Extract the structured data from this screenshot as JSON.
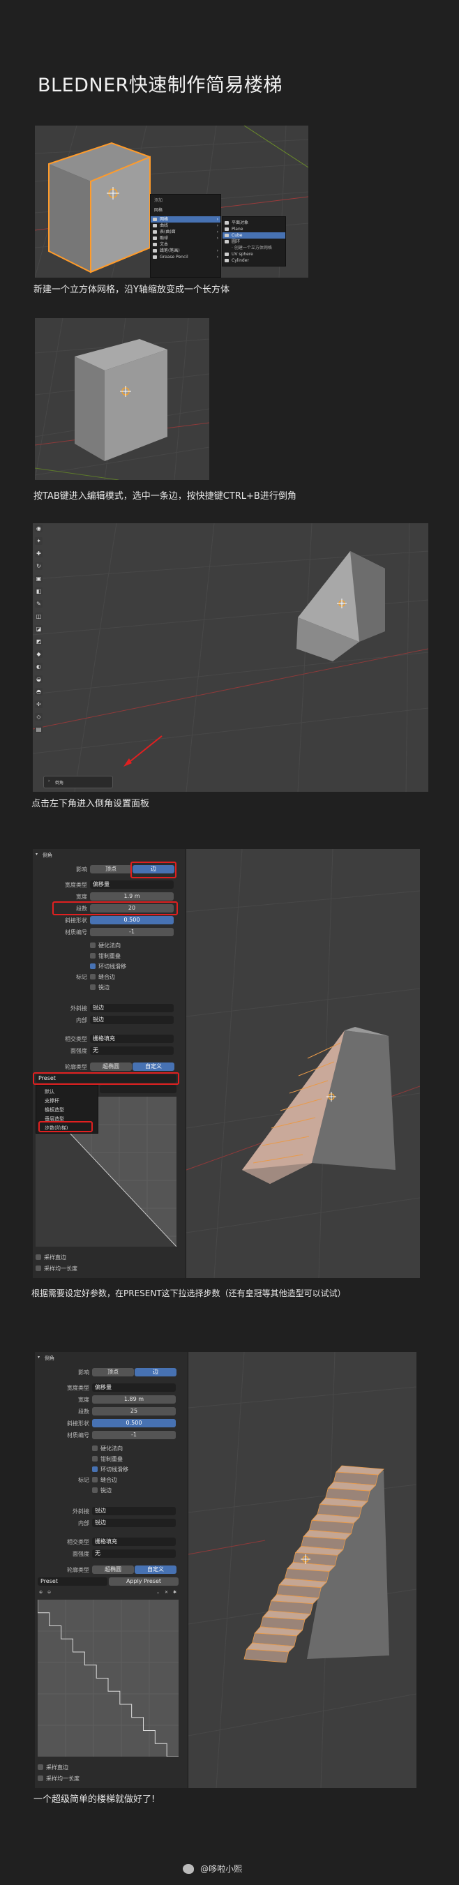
{
  "title": "BLEDNER快速制作简易楼梯",
  "steps": {
    "s1": "新建一个立方体网格，沿Y轴缩放变成一个长方体",
    "s2": "按TAB键进入编辑模式，选中一条边，按快捷键CTRL+B进行倒角",
    "s3": "点击左下角进入倒角设置面板",
    "s4": "根据需要设定好参数，在PRESENT这下拉选择步数（还有皇冠等其他造型可以试试）",
    "s5": "一个超级简单的楼梯就做好了!"
  },
  "add_menu": {
    "header": "添加",
    "title": "网格",
    "items": [
      {
        "label": "网格",
        "icon": "mesh-icon",
        "highlight": true
      },
      {
        "label": "曲线",
        "icon": "curve-icon"
      },
      {
        "label": "表(曲)面",
        "icon": "surface-icon"
      },
      {
        "label": "融球",
        "icon": "metaball-icon"
      },
      {
        "label": "文本",
        "icon": "text-icon"
      },
      {
        "label": "蜡笔(笔画)",
        "icon": "gpencil-icon"
      },
      {
        "label": "Grease Pencil",
        "icon": "grease-pencil-icon"
      }
    ],
    "sub_items": [
      {
        "label": "平面对象"
      },
      {
        "label": "Plane"
      },
      {
        "label": "Cube",
        "highlight": true
      },
      {
        "label": "圆环"
      },
      {
        "label": "· 创建一个立方体网格"
      },
      {
        "label": "UV sphere"
      },
      {
        "label": "Cylinder"
      }
    ]
  },
  "bevel_mini_label": "倒角",
  "panel1": {
    "header": "倒角",
    "affect_label": "影响",
    "affect_vertex": "顶点",
    "affect_edge": "边",
    "width_type_label": "宽度类型",
    "width_type": "偏移量",
    "width_label": "宽度",
    "width": "1.9 m",
    "segments_label": "段数",
    "segments": "20",
    "shape_label": "斜接形状",
    "shape": "0.500",
    "material_label": "材质编号",
    "material": "-1",
    "opt_harden": "硬化法向",
    "opt_clamp": "钳制重叠",
    "opt_loop": "环切线滑移",
    "mark_label": "标记",
    "opt_seam": "缝合边",
    "opt_sharp": "锐边",
    "outer_label": "外斜接",
    "outer": "锐边",
    "inner_label": "内部",
    "inner": "锐边",
    "fill_label": "相交类型",
    "fill": "栅格填充",
    "face_label": "面强度",
    "face": "无",
    "profile_label": "轮廓类型",
    "profile_a": "超椭圆",
    "profile_b": "自定义",
    "preset": "Preset",
    "preset_opts": [
      "默认",
      "支撑杆",
      "檐板造型",
      "垂层造型",
      "步数(阶梯)"
    ],
    "opt_sample": "采样直边",
    "opt_even": "采样均一长度"
  },
  "panel2": {
    "header": "倒角",
    "affect_label": "影响",
    "affect_vertex": "顶点",
    "affect_edge": "边",
    "width_type_label": "宽度类型",
    "width_type": "偏移量",
    "width_label": "宽度",
    "width": "1.89 m",
    "segments_label": "段数",
    "segments": "25",
    "shape_label": "斜接形状",
    "shape": "0.500",
    "material_label": "材质编号",
    "material": "-1",
    "opt_harden": "硬化法向",
    "opt_clamp": "钳制重叠",
    "opt_loop": "环切线滑移",
    "mark_label": "标记",
    "opt_seam": "缝合边",
    "opt_sharp": "锐边",
    "outer_label": "外斜接",
    "outer": "锐边",
    "inner_label": "内部",
    "inner": "锐边",
    "fill_label": "相交类型",
    "fill": "栅格填充",
    "face_label": "面强度",
    "face": "无",
    "profile_label": "轮廓类型",
    "profile_a": "超椭圆",
    "profile_b": "自定义",
    "preset": "Preset",
    "apply_preset": "Apply Preset",
    "opt_sample": "采样直边",
    "opt_even": "采样均一长度"
  },
  "watermark": "@哆啦小熙"
}
